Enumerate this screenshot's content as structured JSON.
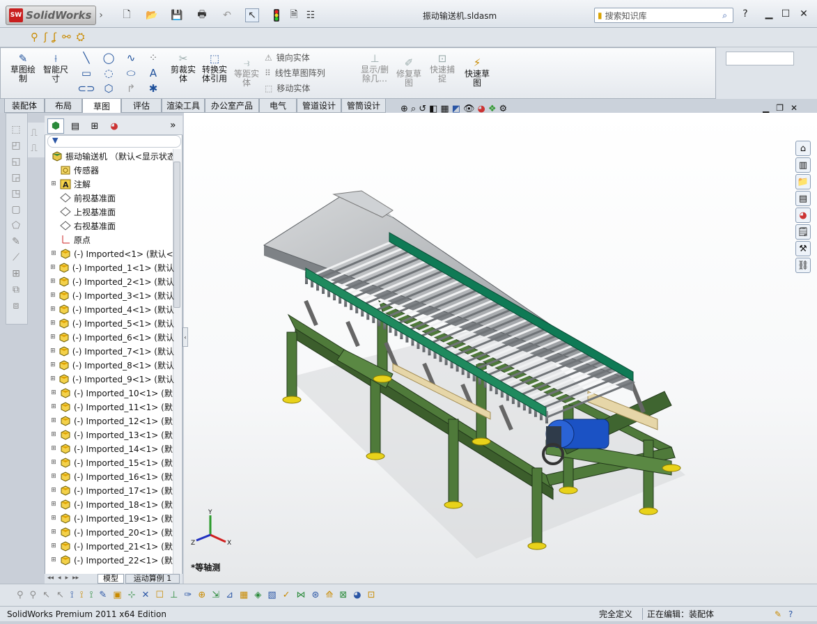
{
  "app": {
    "logo_text": "SolidWorks",
    "doc_title": "振动输送机.sldasm",
    "search_placeholder": "搜索知识库"
  },
  "ribbon": {
    "sketch": "草图绘\n制",
    "smart_dim": "智能尺\n寸",
    "trim": "剪裁实\n体",
    "convert": "转换实\n体引用",
    "offset": "等距实\n体",
    "mirror": "镜向实体",
    "linear_pattern": "线性草图阵列",
    "move": "移动实体",
    "display_delete": "显示/删\n除几…",
    "repair": "修复草\n图",
    "quick_snaps": "快速捕\n捉",
    "rapid_sketch": "快速草\n图"
  },
  "tabs": [
    "装配体",
    "布局",
    "草图",
    "评估",
    "渲染工具",
    "办公室产品",
    "电气",
    "管道设计",
    "管筒设计"
  ],
  "active_tab": "草图",
  "tree": {
    "root": "振动输送机 （默认<显示状态-",
    "items": [
      "传感器",
      "注解",
      "前视基准面",
      "上视基准面",
      "右视基准面",
      "原点"
    ],
    "parts": [
      "(-) Imported<1> (默认<",
      "(-) Imported_1<1> (默认",
      "(-) Imported_2<1> (默认",
      "(-) Imported_3<1> (默认",
      "(-) Imported_4<1> (默认",
      "(-) Imported_5<1> (默认",
      "(-) Imported_6<1> (默认",
      "(-) Imported_7<1> (默认",
      "(-) Imported_8<1> (默认",
      "(-) Imported_9<1> (默认",
      "(-) Imported_10<1> (默",
      "(-) Imported_11<1> (默",
      "(-) Imported_12<1> (默",
      "(-) Imported_13<1> (默",
      "(-) Imported_14<1> (默",
      "(-) Imported_15<1> (默",
      "(-) Imported_16<1> (默",
      "(-) Imported_17<1> (默",
      "(-) Imported_18<1> (默",
      "(-) Imported_19<1> (默",
      "(-) Imported_20<1> (默",
      "(-) Imported_21<1> (默",
      "(-) Imported_22<1> (默"
    ]
  },
  "bottom_tabs": [
    "模型",
    "运动算例 1"
  ],
  "viewport": {
    "view_label": "*等轴测"
  },
  "status": {
    "edition": "SolidWorks Premium 2011 x64 Edition",
    "defined": "完全定义",
    "editing": "正在编辑：装配体"
  },
  "triad": {
    "x": "X",
    "y": "Y",
    "z": "Z"
  },
  "colors": {
    "frame_green": "#4f7a3a",
    "tray_gray": "#a9adb0",
    "motor_blue": "#1b52c4",
    "accent_yellow": "#e8d21a"
  }
}
